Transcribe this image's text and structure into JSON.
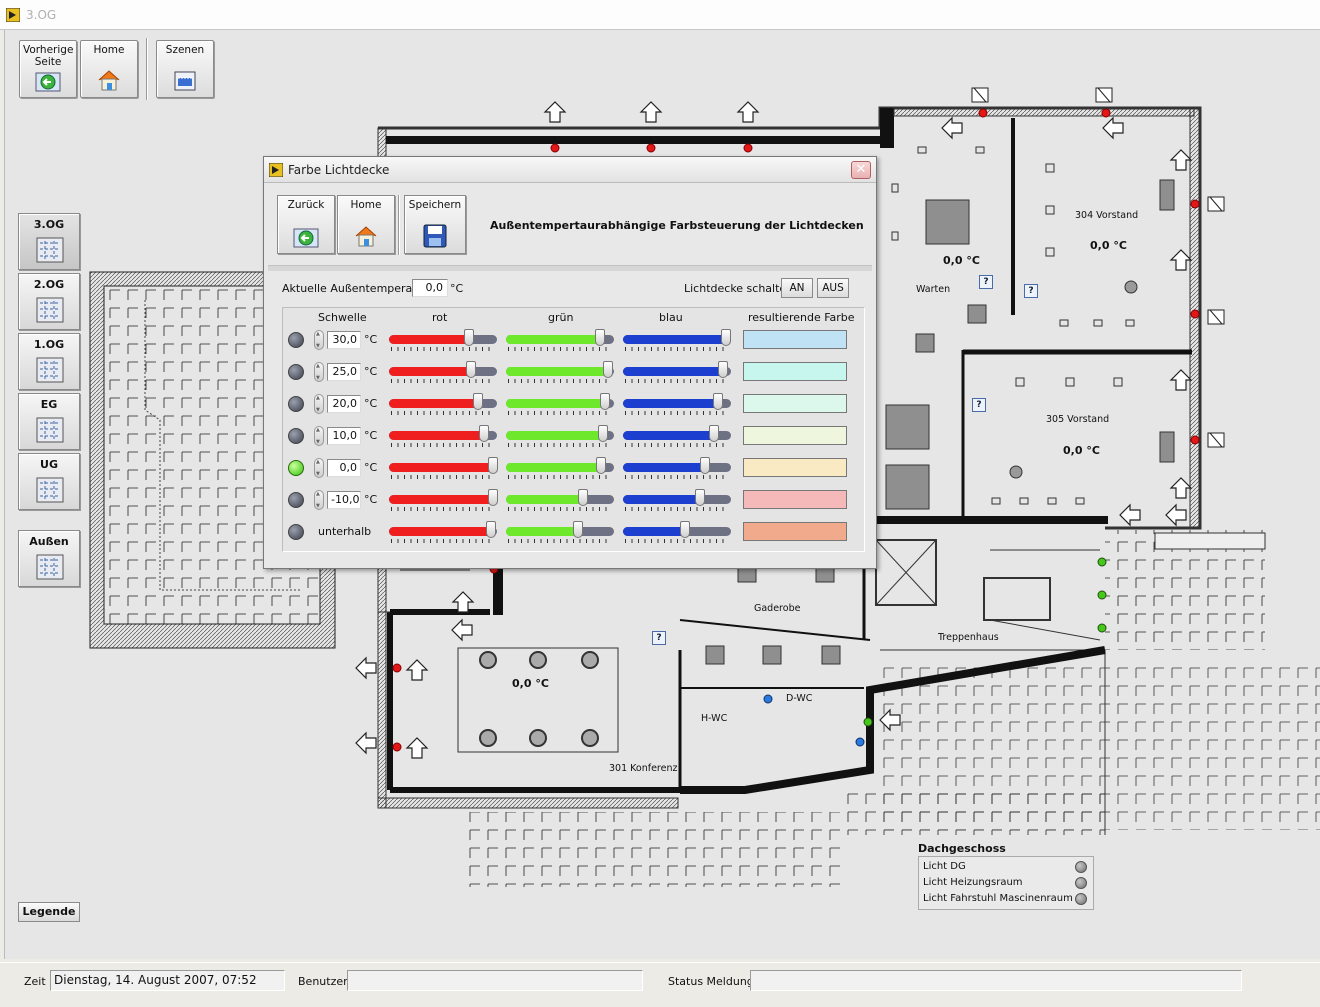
{
  "window": {
    "title": "3.OG"
  },
  "toolbar": {
    "back_label": "Vorherige Seite",
    "home_label": "Home",
    "scenes_label": "Szenen"
  },
  "floors": [
    {
      "label": "3.OG",
      "active": true
    },
    {
      "label": "2.OG",
      "active": false
    },
    {
      "label": "1.OG",
      "active": false
    },
    {
      "label": "EG",
      "active": false
    },
    {
      "label": "UG",
      "active": false
    },
    {
      "label": "Außen",
      "active": false
    }
  ],
  "legend_button": "Legende",
  "floorplan": {
    "rooms": [
      {
        "name": "304 Vorstand",
        "temp": "0,0 °C"
      },
      {
        "name": "305 Vorstand",
        "temp": "0,0 °C"
      },
      {
        "name": "Warten",
        "temp": "0,0 °C"
      },
      {
        "name": "301 Konferenz",
        "temp": "0,0 °C"
      },
      {
        "name": "Gaderobe"
      },
      {
        "name": "Treppenhaus"
      },
      {
        "name": "D-WC"
      },
      {
        "name": "H-WC"
      }
    ],
    "help_glyph": "?"
  },
  "dachgeschoss": {
    "title": "Dachgeschoss",
    "items": [
      "Licht DG",
      "Licht Heizungsraum",
      "Licht Fahrstuhl Mascinenraum"
    ]
  },
  "statusbar": {
    "time_label": "Zeit",
    "time_value": "Dienstag, 14. August 2007, 07:52",
    "user_label": "Benutzer",
    "user_value": "",
    "status_label": "Status Meldung",
    "status_value": ""
  },
  "dialog": {
    "title": "Farbe Lichtdecke",
    "close_glyph": "✕",
    "buttons": {
      "back": "Zurück",
      "home": "Home",
      "save": "Speichern"
    },
    "heading": "Außentempertaurabhängige Farbsteuerung der Lichtdecken",
    "outside_temp_label": "Aktuelle Außentemperatur",
    "outside_temp_value": "0,0",
    "unit": "°C",
    "switch_label": "Lichtdecke schalten",
    "switch_on": "AN",
    "switch_off": "AUS",
    "columns": {
      "threshold": "Schwelle",
      "red": "rot",
      "green": "grün",
      "blue": "blau",
      "result": "resultierende Farbe"
    },
    "colors": {
      "red": "#ef1f1f",
      "green": "#6ee82b",
      "blue": "#1c3fd0"
    },
    "rows": [
      {
        "threshold": "30,0",
        "active": false,
        "red": 0.74,
        "green": 0.87,
        "blue": 0.95,
        "result": "#bfe3f5"
      },
      {
        "threshold": "25,0",
        "active": false,
        "red": 0.76,
        "green": 0.94,
        "blue": 0.93,
        "result": "#c7f6ee"
      },
      {
        "threshold": "20,0",
        "active": false,
        "red": 0.82,
        "green": 0.92,
        "blue": 0.88,
        "result": "#dcf7ec"
      },
      {
        "threshold": "10,0",
        "active": false,
        "red": 0.88,
        "green": 0.9,
        "blue": 0.84,
        "result": "#eef6de"
      },
      {
        "threshold": "0,0",
        "active": true,
        "red": 0.96,
        "green": 0.88,
        "blue": 0.76,
        "result": "#faeac3"
      },
      {
        "threshold": "-10,0",
        "active": false,
        "red": 0.96,
        "green": 0.71,
        "blue": 0.71,
        "result": "#f6b9b9"
      },
      {
        "threshold": null,
        "label": "unterhalb",
        "active": false,
        "red": 0.94,
        "green": 0.67,
        "blue": 0.57,
        "result": "#f2aa8c"
      }
    ]
  }
}
